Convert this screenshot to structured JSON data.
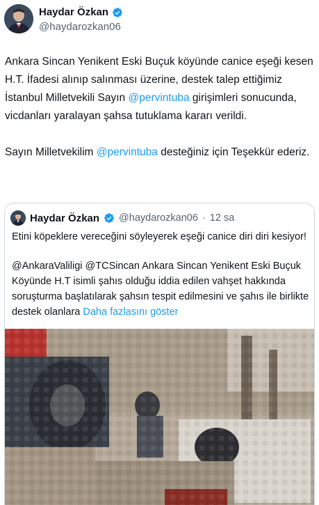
{
  "author": {
    "name": "Haydar Özkan",
    "handle": "@haydarozkan06",
    "verified": true,
    "badge_color": "#1d9bf0"
  },
  "tweet": {
    "para1": {
      "text_before": "Ankara Sincan Yenikent Eski Buçuk köyünde canice eşeği kesen H.T. İfadesi alınıp salınması üzerine, destek talep ettiğimiz İstanbul Milletvekili Sayın ",
      "mention": "@pervintuba",
      "text_after": " girişimleri sonucunda, vicdanları yaralayan şahsa tutuklama kararı verildi."
    },
    "para2": {
      "text_before": "Sayın Milletvekilim ",
      "mention": "@pervintuba",
      "text_after": " desteğiniz için Teşekkür ederiz."
    }
  },
  "quote": {
    "name": "Haydar Özkan",
    "handle": "@haydarozkan06",
    "separator": " · ",
    "time": "12 sa",
    "para1": "Etini köpeklere vereceğini söyleyerek eşeği canice diri diri kesiyor!",
    "para2": "@AnkaraValiligi @TCSincan Ankara Sincan Yenikent Eski Buçuk Köyünde H.T isimli şahıs olduğu iddia edilen vahşet hakkında soruşturma başlatılarak şahsın tespit edilmesini ve şahıs ile birlikte destek olanlara ",
    "more_label": "Daha fazlasını göster",
    "media_icon": "blurred-video-thumbnail"
  },
  "colors": {
    "text": "#0f1419",
    "secondary": "#536471",
    "link": "#1d9bf0",
    "border": "#cfd9de"
  }
}
